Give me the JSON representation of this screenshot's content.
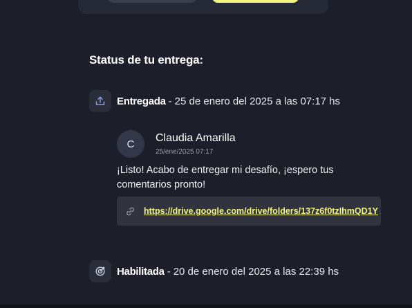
{
  "status_section": {
    "title": "Status de tu entrega:"
  },
  "events": [
    {
      "icon": "upload-icon",
      "label": "Entregada",
      "separator": "-",
      "date_text": "25 de enero del 2025 a las 07:17 hs"
    },
    {
      "icon": "target-icon",
      "label": "Habilitada",
      "separator": "-",
      "date_text": "20 de enero del 2025 a las 22:39 hs"
    }
  ],
  "comment": {
    "avatar_initial": "C",
    "author": "Claudia Amarilla",
    "date": "25/ene/2025 07:17",
    "text": "¡Listo! Acabo de entregar mi desafío, ¡espero tus comentarios pronto!",
    "link_icon": "link-icon",
    "link_url": "https://drive.google.com/drive/folders/137z6f0tzIhmQD1Y"
  },
  "colors": {
    "background": "#1c1e29",
    "accent": "#f2f57e",
    "icon_blue": "#8fa3e8"
  }
}
